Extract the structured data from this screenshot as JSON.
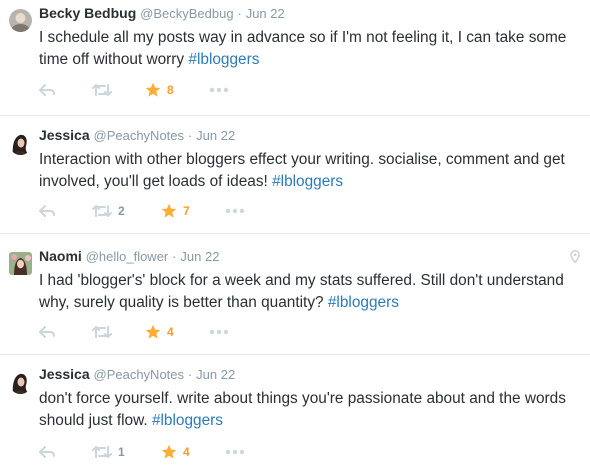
{
  "colors": {
    "hashtag": "#2b7bb9",
    "favorite": "#ffac33",
    "icon_gray": "#ccd6dd",
    "meta_gray": "#8899a6"
  },
  "tweets": [
    {
      "fullname": "Becky Bedbug",
      "handle": "@BeckyBedbug",
      "sep": "·",
      "date": "Jun 22",
      "text": "I schedule all my posts way in advance so if I'm not feeling it, I can take some time off without worry ",
      "hashtag": "#lbloggers",
      "retweets": "",
      "favorites": "8",
      "avatar_icon": "avatar-becky"
    },
    {
      "fullname": "Jessica",
      "handle": "@PeachyNotes",
      "sep": "·",
      "date": "Jun 22",
      "text": "Interaction with other bloggers effect your writing. socialise, comment and get involved, you'll get loads of ideas! ",
      "hashtag": "#lbloggers",
      "retweets": "2",
      "favorites": "7",
      "avatar_icon": "avatar-jessica"
    },
    {
      "fullname": "Naomi",
      "handle": "@hello_flower",
      "sep": "·",
      "date": "Jun 22",
      "text": "I had 'blogger's' block for a week and my stats suffered. Still don't understand why, surely quality is better than quantity? ",
      "hashtag": "#lbloggers",
      "retweets": "",
      "favorites": "4",
      "avatar_icon": "avatar-naomi",
      "geo_icon": "location-pin-icon"
    },
    {
      "fullname": "Jessica",
      "handle": "@PeachyNotes",
      "sep": "·",
      "date": "Jun 22",
      "text": "don't force yourself. write about things you're passionate about and the words should just flow. ",
      "hashtag": "#lbloggers",
      "retweets": "1",
      "favorites": "4",
      "avatar_icon": "avatar-jessica"
    }
  ]
}
